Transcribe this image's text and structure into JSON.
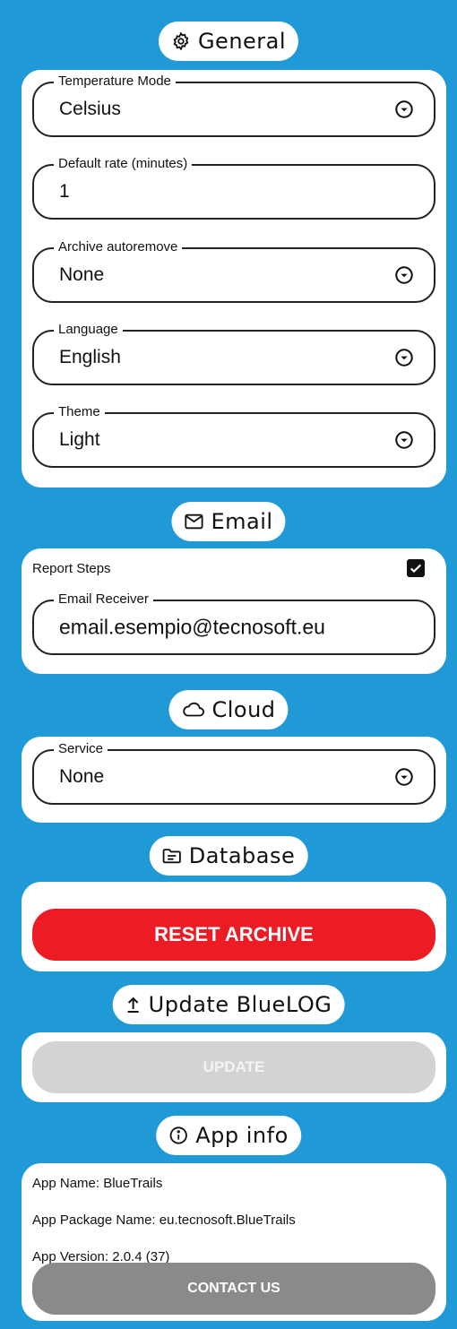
{
  "general": {
    "title": "General",
    "fields": {
      "temperature": {
        "label": "Temperature Mode",
        "value": "Celsius"
      },
      "rate": {
        "label": "Default rate (minutes)",
        "value": "1"
      },
      "archive": {
        "label": "Archive autoremove",
        "value": "None"
      },
      "language": {
        "label": "Language",
        "value": "English"
      },
      "theme": {
        "label": "Theme",
        "value": "Light"
      }
    }
  },
  "email": {
    "title": "Email",
    "report_steps_label": "Report Steps",
    "report_steps_checked": true,
    "receiver": {
      "label": "Email Receiver",
      "value": "email.esempio@tecnosoft.eu"
    }
  },
  "cloud": {
    "title": "Cloud",
    "service": {
      "label": "Service",
      "value": "None"
    }
  },
  "database": {
    "title": "Database",
    "reset_label": "RESET ARCHIVE"
  },
  "update": {
    "title": "Update BlueLOG",
    "update_label": "UPDATE"
  },
  "app_info": {
    "title": "App info",
    "app_name": "App Name: BlueTrails",
    "package_name": "App Package Name: eu.tecnosoft.BlueTrails",
    "version": "App Version: 2.0.4 (37)",
    "contact_label": "CONTACT US"
  },
  "colors": {
    "background": "#1f9ad7",
    "danger": "#ed1c24",
    "disabled": "#d3d3d3",
    "neutral": "#8a8a8a"
  }
}
